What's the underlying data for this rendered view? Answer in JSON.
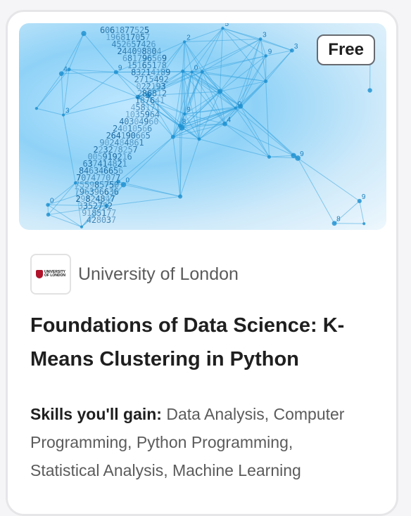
{
  "badge": {
    "label": "Free"
  },
  "partner": {
    "name": "University of London",
    "logo_text_line1": "UNIVERSITY",
    "logo_text_line2": "OF LONDON"
  },
  "course": {
    "title": "Foundations of Data Science: K-Means Clustering in Python"
  },
  "skills": {
    "label": "Skills you'll gain:",
    "text": "Data Analysis, Computer Programming, Python Programming, Statistical Analysis, Machine Learning"
  },
  "hero": {
    "icon": "data-science-dna-image",
    "accent": "#1aa3e8",
    "digits": [
      "2",
      "7",
      "4",
      "1",
      "0",
      "5",
      "9",
      "6",
      "3",
      "8"
    ]
  }
}
